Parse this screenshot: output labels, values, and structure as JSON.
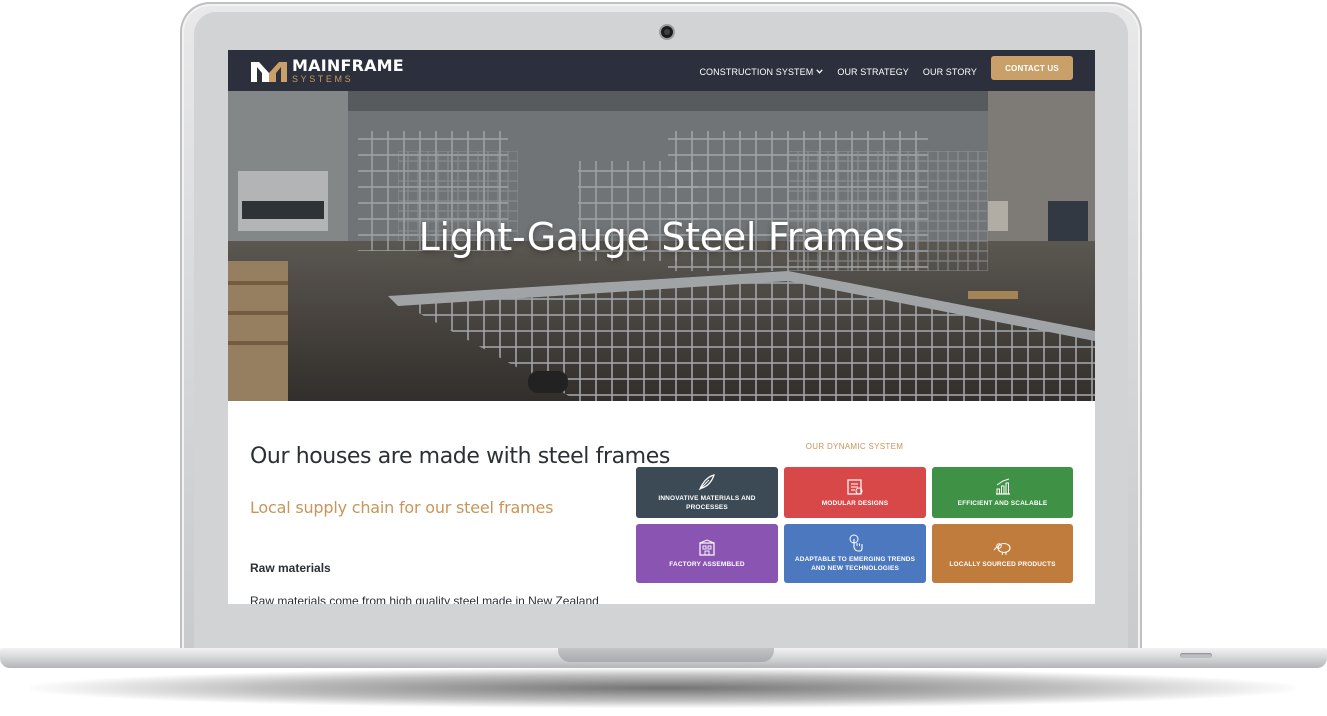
{
  "brand": {
    "name": "MAINFRAME",
    "tagline": "SYSTEMS",
    "colors": {
      "navy": "#2b303c",
      "gold": "#c9a06a"
    }
  },
  "nav": {
    "items": [
      {
        "label": "CONSTRUCTION SYSTEM",
        "has_dropdown": true
      },
      {
        "label": "OUR STRATEGY"
      },
      {
        "label": "OUR STORY"
      }
    ],
    "cta": "CONTACT US"
  },
  "hero": {
    "title": "Light-Gauge Steel Frames"
  },
  "main": {
    "heading": "Our houses are made with steel frames",
    "subheading": "Local supply chain for our steel frames",
    "section_label": "Raw materials",
    "paragraph": "Raw materials come from high quality steel made in New Zealand"
  },
  "system": {
    "title": "OUR DYNAMIC SYSTEM",
    "tiles": [
      {
        "label": "INNOVATIVE MATERIALS AND PROCESSES",
        "color": "#3b4a55",
        "icon": "feather-icon"
      },
      {
        "label": "MODULAR DESIGNS",
        "color": "#d94848",
        "icon": "blueprint-icon"
      },
      {
        "label": "EFFICIENT AND SCALABLE",
        "color": "#3f9145",
        "icon": "growth-chart-icon"
      },
      {
        "label": "FACTORY ASSEMBLED",
        "color": "#8a54b3",
        "icon": "factory-icon"
      },
      {
        "label": "ADAPTABLE TO EMERGING TRENDS AND NEW TECHNOLOGIES",
        "color": "#4b78bf",
        "icon": "touch-icon"
      },
      {
        "label": "LOCALLY SOURCED PRODUCTS",
        "color": "#c07c3d",
        "icon": "kiwi-bird-icon"
      }
    ]
  }
}
